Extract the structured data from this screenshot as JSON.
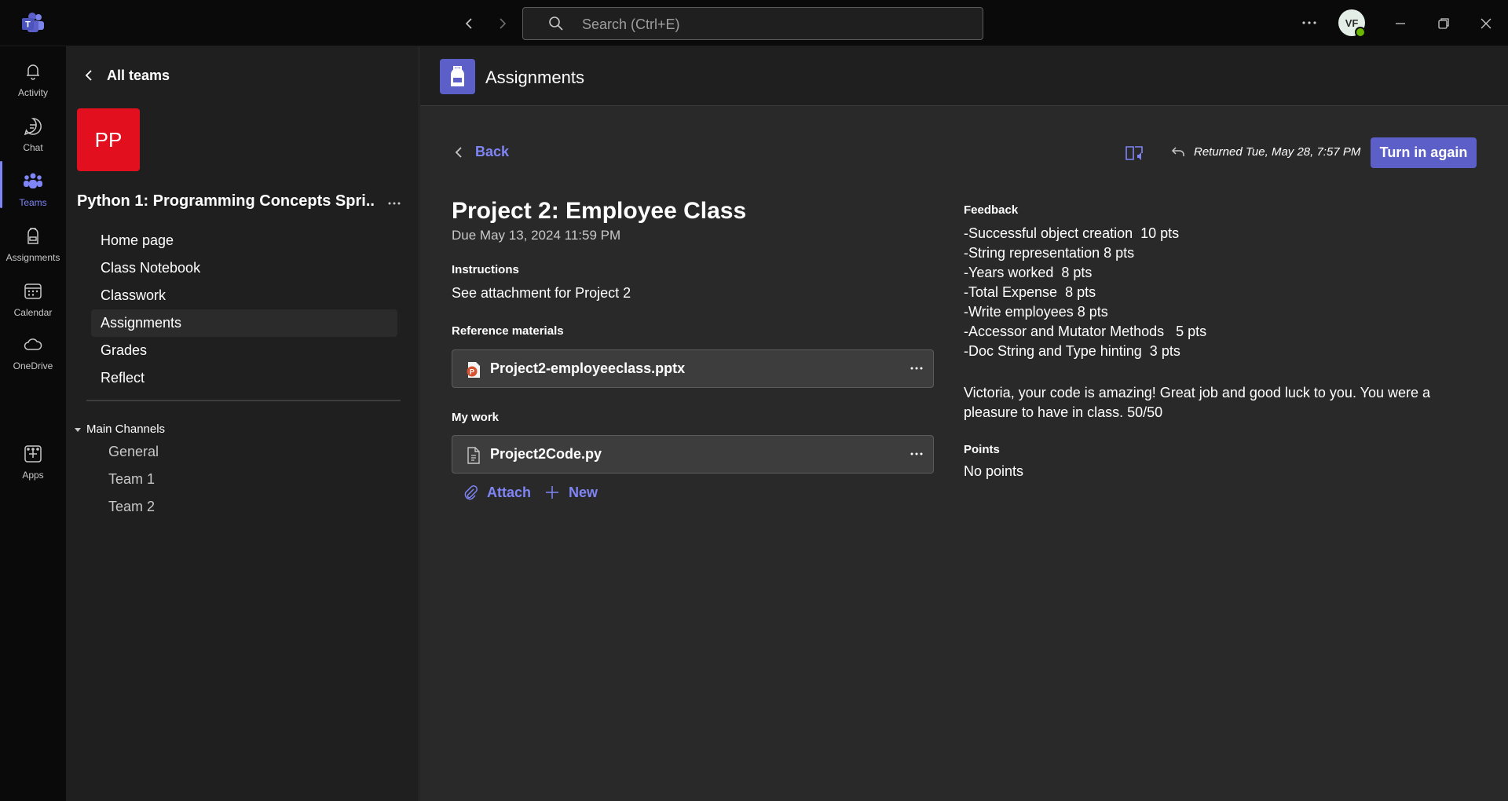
{
  "titlebar": {
    "search_placeholder": "Search (Ctrl+E)",
    "avatar_initials": "VF"
  },
  "rail": {
    "items": [
      {
        "label": "Activity",
        "icon": "bell-icon"
      },
      {
        "label": "Chat",
        "icon": "chat-icon"
      },
      {
        "label": "Teams",
        "icon": "teams-icon"
      },
      {
        "label": "Assignments",
        "icon": "backpack-icon"
      },
      {
        "label": "Calendar",
        "icon": "calendar-icon"
      },
      {
        "label": "OneDrive",
        "icon": "cloud-icon"
      },
      {
        "label": "Apps",
        "icon": "add-app-icon"
      }
    ],
    "active": "Teams",
    "accent": "#7f85f5"
  },
  "panel": {
    "all_teams": "All teams",
    "team_initials": "PP",
    "team_tile_color": "#e2101f",
    "team_name": "Python 1: Programming Concepts Spri...",
    "nav": [
      "Home page",
      "Class Notebook",
      "Classwork",
      "Assignments",
      "Grades",
      "Reflect"
    ],
    "selected_nav": "Assignments",
    "channels_header": "Main Channels",
    "channels": [
      "General",
      "Team 1",
      "Team 2"
    ]
  },
  "main": {
    "title": "Assignments",
    "back_label": "Back",
    "returned_text": "Returned Tue, May 28, 7:57 PM",
    "turn_in_label": "Turn in again",
    "button_color": "#5b5fc7",
    "project_title": "Project 2: Employee Class",
    "due": "Due May 13, 2024 11:59 PM",
    "instructions_label": "Instructions",
    "instructions_text": "See attachment for Project 2",
    "reference_label": "Reference materials",
    "reference_file": "Project2-employeeclass.pptx",
    "my_work_label": "My work",
    "my_work_file": "Project2Code.py",
    "attach_label": "Attach",
    "new_label": "New",
    "feedback_label": "Feedback",
    "feedback_lines": [
      "-Successful object creation  10 pts",
      "-String representation 8 pts",
      "-Years worked  8 pts",
      "-Total Expense  8 pts",
      "-Write employees 8 pts",
      "-Accessor and Mutator Methods   5 pts",
      "-Doc String and Type hinting  3 pts"
    ],
    "feedback_message": "Victoria, your code is amazing! Great job and good luck to you. You were a pleasure to have in class. 50/50",
    "points_label": "Points",
    "points_value": "No points"
  }
}
